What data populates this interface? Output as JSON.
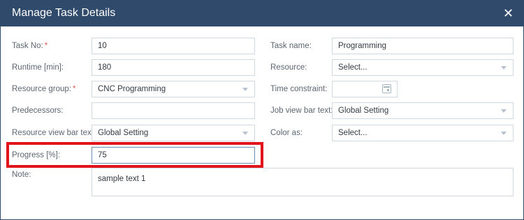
{
  "dialog": {
    "title": "Manage Task Details",
    "close_glyph": "✕"
  },
  "left": {
    "task_no": {
      "label": "Task No:",
      "required_mark": "*",
      "value": "10"
    },
    "runtime": {
      "label": "Runtime [min]:",
      "value": "180"
    },
    "resource_group": {
      "label": "Resource group:",
      "required_mark": "*",
      "value": "CNC Programming"
    },
    "predecessors": {
      "label": "Predecessors:",
      "value": ""
    },
    "resource_view_bar_text": {
      "label": "Resource view bar text:",
      "value": "Global Setting"
    },
    "progress": {
      "label": "Progress [%]:",
      "value": "75"
    },
    "note": {
      "label": "Note:",
      "value": "sample text 1"
    }
  },
  "right": {
    "task_name": {
      "label": "Task name:",
      "value": "Programming"
    },
    "resource": {
      "label": "Resource:",
      "value": "Select..."
    },
    "time_constraint": {
      "label": "Time constraint:",
      "value": ""
    },
    "job_view_bar_text": {
      "label": "Job view bar text:",
      "value": "Global Setting"
    },
    "color_as": {
      "label": "Color as:",
      "value": "Select..."
    }
  },
  "colors": {
    "header": "#2f4a6b",
    "required": "#e05a5a",
    "highlight": "#e0141a"
  },
  "icons": {
    "close": "close-icon",
    "calendar": "calendar-icon",
    "dropdown": "chevron-down-icon"
  }
}
